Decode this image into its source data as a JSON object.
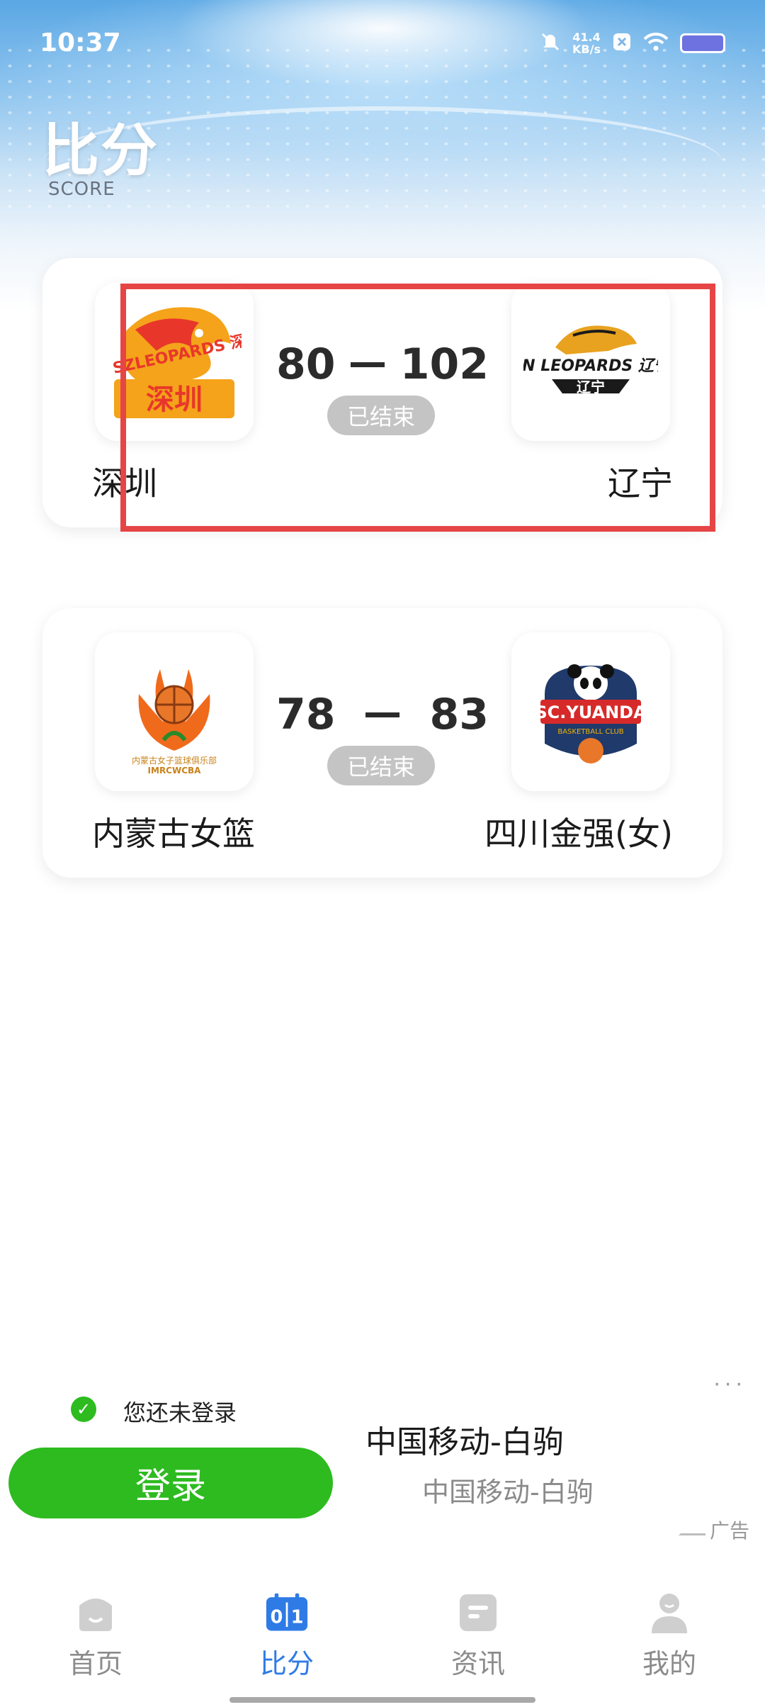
{
  "status_bar": {
    "time": "10:37",
    "net_speed_value": "41.4",
    "net_speed_unit": "KB/s",
    "icons": [
      "mute-icon",
      "x-app-icon",
      "wifi-icon",
      "battery-icon"
    ]
  },
  "header": {
    "title": "比分",
    "subtitle": "SCORE"
  },
  "matches": [
    {
      "home_team": "深圳",
      "home_logo_text": "SZLEOPARDS 深圳",
      "home_score": "80",
      "away_score": "102",
      "status": "已结束",
      "away_team": "辽宁",
      "away_logo_text": "LN LEOPARDS 辽宁"
    },
    {
      "home_team": "内蒙古女篮",
      "home_logo_text": "IMRCWCBA",
      "home_score": "78",
      "away_score": "83",
      "status": "已结束",
      "away_team": "四川金强(女)",
      "away_logo_text": "SC.YUANDA",
      "away_logo_subtext": "BASKETBALL CLUB"
    }
  ],
  "ad": {
    "login_hint": "您还未登录",
    "login_button": "登录",
    "title": "中国移动-白驹",
    "subtitle": "中国移动-白驹",
    "tag": "广告",
    "more": "···"
  },
  "tabbar": {
    "items": [
      {
        "label": "首页",
        "icon": "home-icon",
        "active": false
      },
      {
        "label": "比分",
        "icon": "scoreboard-icon",
        "active": true
      },
      {
        "label": "资讯",
        "icon": "news-icon",
        "active": false
      },
      {
        "label": "我的",
        "icon": "profile-icon",
        "active": false
      }
    ]
  },
  "colors": {
    "accent_blue": "#2f7be6",
    "login_green": "#2dbb1f",
    "highlight_red": "#e64545",
    "status_pill_gray": "#c4c4c4"
  }
}
